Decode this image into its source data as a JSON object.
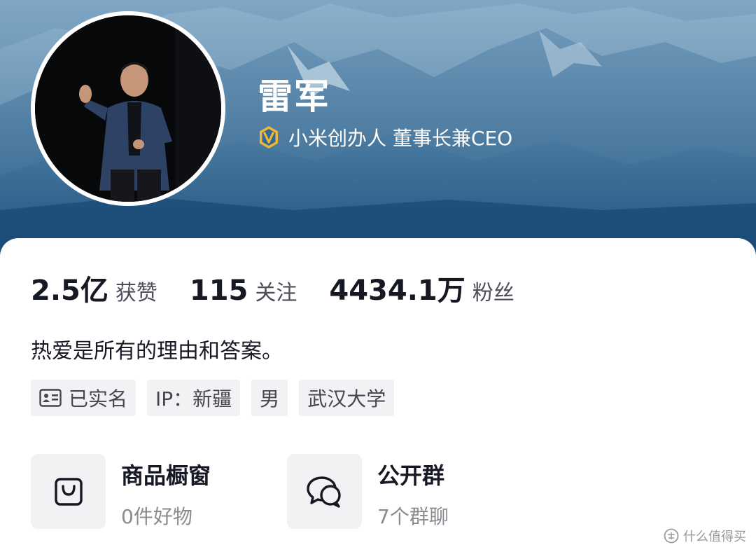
{
  "profile": {
    "name": "雷军",
    "verify_text": "小米创办人 董事长兼CEO"
  },
  "stats": [
    {
      "value": "2.5亿",
      "label": "获赞"
    },
    {
      "value": "115",
      "label": "关注"
    },
    {
      "value": "4434.1万",
      "label": "粉丝"
    }
  ],
  "bio": "热爱是所有的理由和答案。",
  "tags": [
    {
      "icon": "id-card-icon",
      "label": "已实名"
    },
    {
      "label": "IP：新疆"
    },
    {
      "label": "男"
    },
    {
      "label": "武汉大学"
    }
  ],
  "entries": [
    {
      "icon": "shopping-bag-icon",
      "title": "商品橱窗",
      "subtitle": "0件好物"
    },
    {
      "icon": "chat-bubbles-icon",
      "title": "公开群",
      "subtitle": "7个群聊"
    }
  ],
  "watermark": "什么值得买",
  "colors": {
    "banner": "#2c6089",
    "verify_badge": "#f0b63a",
    "tag_bg": "#f2f2f4",
    "text_primary": "#161823",
    "text_secondary": "#8a8b91"
  }
}
